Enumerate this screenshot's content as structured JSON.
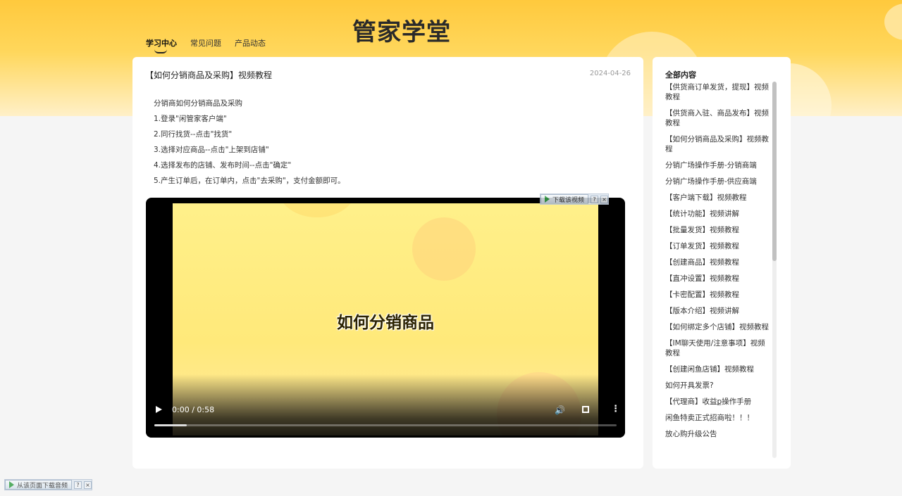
{
  "header": {
    "brand": "管家学堂",
    "tabs": [
      {
        "label": "学习中心",
        "active": true
      },
      {
        "label": "常见问题",
        "active": false
      },
      {
        "label": "产品动态",
        "active": false
      }
    ]
  },
  "article": {
    "title": "【如何分销商品及采购】视频教程",
    "date": "2024-04-26",
    "steps": [
      "分销商如何分销商品及采购",
      "1.登录\"闲管家客户端\"",
      "2.同行找货--点击\"找货\"",
      "3.选择对应商品--点击\"上架到店铺\"",
      "4.选择发布的店铺、发布时间--点击\"确定\"",
      "5.产生订单后，在订单内，点击\"去采购\"，支付金额即可。"
    ]
  },
  "video": {
    "caption": "如何分销商品",
    "time": "0:00 / 0:58",
    "progress": 0.07,
    "icons": {
      "play": "play-icon",
      "volume": "volume-icon",
      "fullscreen": "fullscreen-icon",
      "more": "more-vertical-icon"
    }
  },
  "download_bars": {
    "video_bar_label": "下载该视频",
    "page_bar_label": "从该页面下载音频",
    "help": "?",
    "close": "×"
  },
  "sidebar": {
    "title": "全部内容",
    "items": [
      "【供货商订单发货，提现】视频教程",
      "【供货商入驻、商品发布】视频教程",
      "【如何分销商品及采购】视频教程",
      "分销广场操作手册-分销商端",
      "分销广场操作手册-供应商端",
      "【客户端下载】视频教程",
      "【统计功能】视频讲解",
      "【批量发货】视频教程",
      "【订单发货】视频教程",
      "【创建商品】视频教程",
      "【直冲设置】视频教程",
      "【卡密配置】视频教程",
      "【版本介绍】视频讲解",
      "【如何绑定多个店铺】视频教程",
      "【IM聊天使用/注意事项】视频教程",
      "【创建闲鱼店铺】视频教程",
      "如何开具发票?",
      "【代理商】收益ք操作手册",
      "闲鱼特卖正式招商啦！！！",
      "放心购升级公告"
    ]
  },
  "colors": {
    "accent": "#ffc93d",
    "background": "#f5f5f5"
  }
}
